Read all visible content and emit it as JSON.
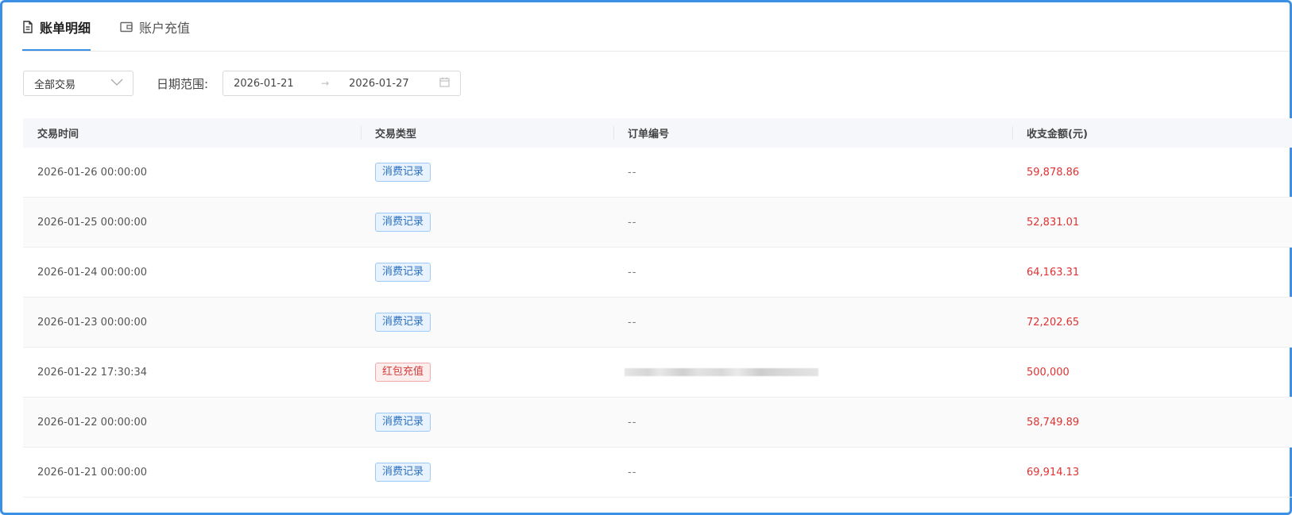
{
  "tabs": [
    {
      "label": "账单明细",
      "icon": "document-icon",
      "active": true
    },
    {
      "label": "账户充值",
      "icon": "wallet-icon",
      "active": false
    }
  ],
  "filters": {
    "type_select": "全部交易",
    "date_label": "日期范围:",
    "date_start": "2026-01-21",
    "date_end": "2026-01-27",
    "arrow": "→"
  },
  "table": {
    "headers": [
      "交易时间",
      "交易类型",
      "订单编号",
      "收支金额(元)"
    ],
    "rows": [
      {
        "time": "2026-01-26 00:00:00",
        "type": "消费记录",
        "type_color": "blue",
        "order": "--",
        "amount": "59,878.86"
      },
      {
        "time": "2026-01-25 00:00:00",
        "type": "消费记录",
        "type_color": "blue",
        "order": "--",
        "amount": "52,831.01"
      },
      {
        "time": "2026-01-24 00:00:00",
        "type": "消费记录",
        "type_color": "blue",
        "order": "--",
        "amount": "64,163.31"
      },
      {
        "time": "2026-01-23 00:00:00",
        "type": "消费记录",
        "type_color": "blue",
        "order": "--",
        "amount": "72,202.65"
      },
      {
        "time": "2026-01-22 17:30:34",
        "type": "红包充值",
        "type_color": "red",
        "order": "",
        "order_redacted": true,
        "amount": "500,000"
      },
      {
        "time": "2026-01-22 00:00:00",
        "type": "消费记录",
        "type_color": "blue",
        "order": "--",
        "amount": "58,749.89"
      },
      {
        "time": "2026-01-21 00:00:00",
        "type": "消费记录",
        "type_color": "blue",
        "order": "--",
        "amount": "69,914.13"
      }
    ]
  },
  "colors": {
    "accent": "#3b8fe5",
    "amount": "#e03232",
    "tag_blue": "#2b6fbf",
    "tag_red": "#d33b3b"
  }
}
